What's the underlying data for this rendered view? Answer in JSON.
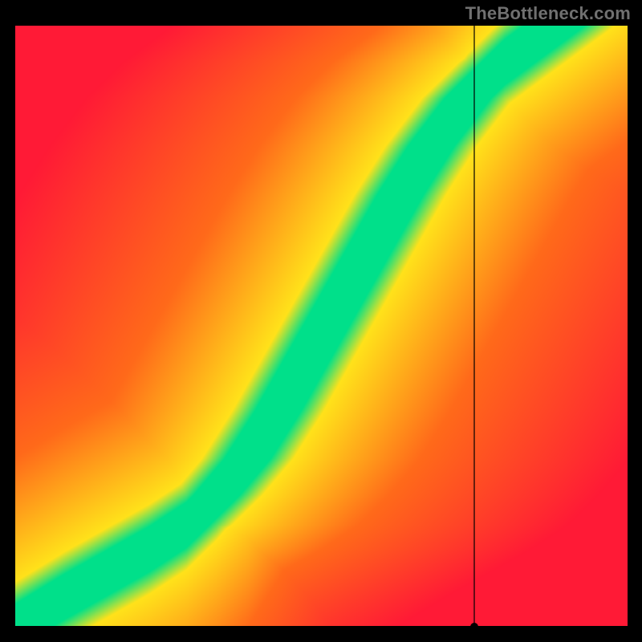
{
  "watermark": "TheBottleneck.com",
  "chart_data": {
    "type": "heatmap",
    "title": "",
    "xlabel": "",
    "ylabel": "",
    "x_range": [
      0,
      100
    ],
    "y_range": [
      0,
      100
    ],
    "marker_x": 75,
    "marker_y": 0,
    "legend": false,
    "description": "Bottleneck compatibility heatmap: green band = balanced pairing, red = severe bottleneck, yellow/orange = moderate bottleneck.",
    "ideal_curve": [
      {
        "x": 0,
        "y": 0
      },
      {
        "x": 8,
        "y": 5
      },
      {
        "x": 15,
        "y": 9
      },
      {
        "x": 22,
        "y": 13
      },
      {
        "x": 28,
        "y": 17
      },
      {
        "x": 33,
        "y": 22
      },
      {
        "x": 38,
        "y": 28
      },
      {
        "x": 43,
        "y": 36
      },
      {
        "x": 48,
        "y": 45
      },
      {
        "x": 53,
        "y": 54
      },
      {
        "x": 58,
        "y": 63
      },
      {
        "x": 63,
        "y": 72
      },
      {
        "x": 68,
        "y": 80
      },
      {
        "x": 74,
        "y": 88
      },
      {
        "x": 80,
        "y": 94
      },
      {
        "x": 88,
        "y": 100
      }
    ],
    "band_width_pct": 5
  },
  "colors": {
    "red": "#ff1a36",
    "orange": "#ff6a1a",
    "yellow": "#ffe21a",
    "green": "#00e08a"
  }
}
